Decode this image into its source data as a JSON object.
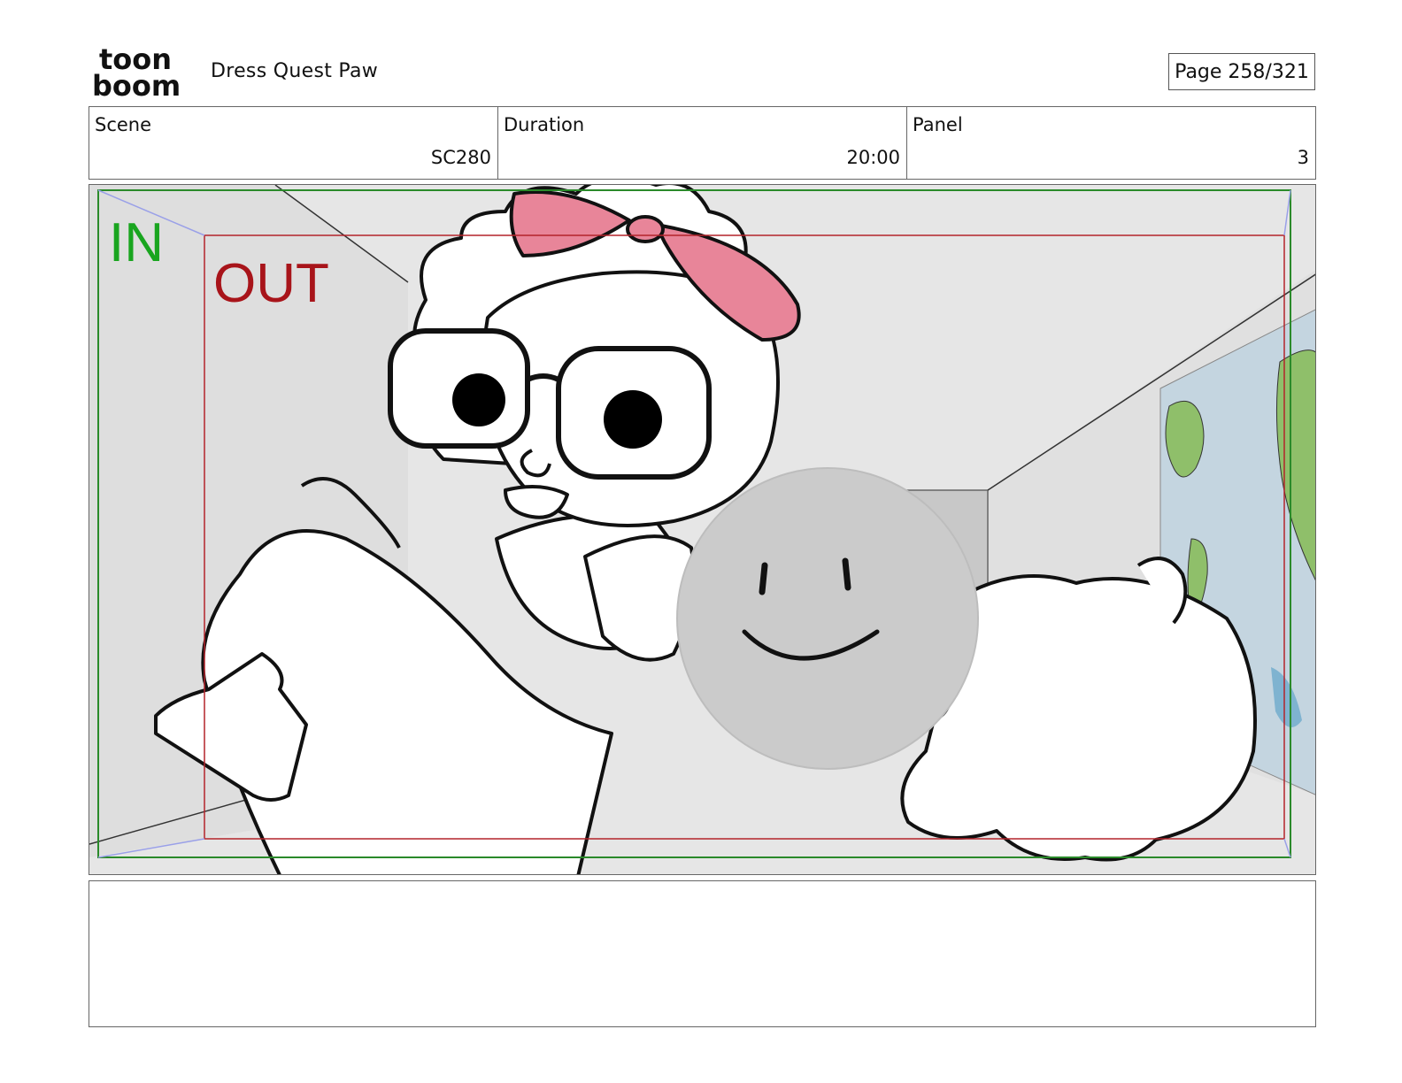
{
  "header": {
    "logo": {
      "line1": "toon",
      "line2": "boom",
      "icon": "toonboom-logo"
    },
    "project_title": "Dress Quest Paw",
    "page_label": "Page 258/321"
  },
  "info_row": [
    {
      "label": "Scene",
      "value": "SC280"
    },
    {
      "label": "Duration",
      "value": "20:00"
    },
    {
      "label": "Panel",
      "value": "3"
    }
  ],
  "panel": {
    "in_label": "IN",
    "out_label": "OUT",
    "colors": {
      "in_frame": "#2a8a2a",
      "in_text": "#19a51f",
      "out_frame": "#b3232a",
      "out_text": "#a8141a",
      "bow": "#e88599",
      "map_water": "#c4d5e0",
      "map_land": "#8fbf6a",
      "smiley": "#cbcbcb"
    }
  },
  "notes": {
    "text": ""
  }
}
